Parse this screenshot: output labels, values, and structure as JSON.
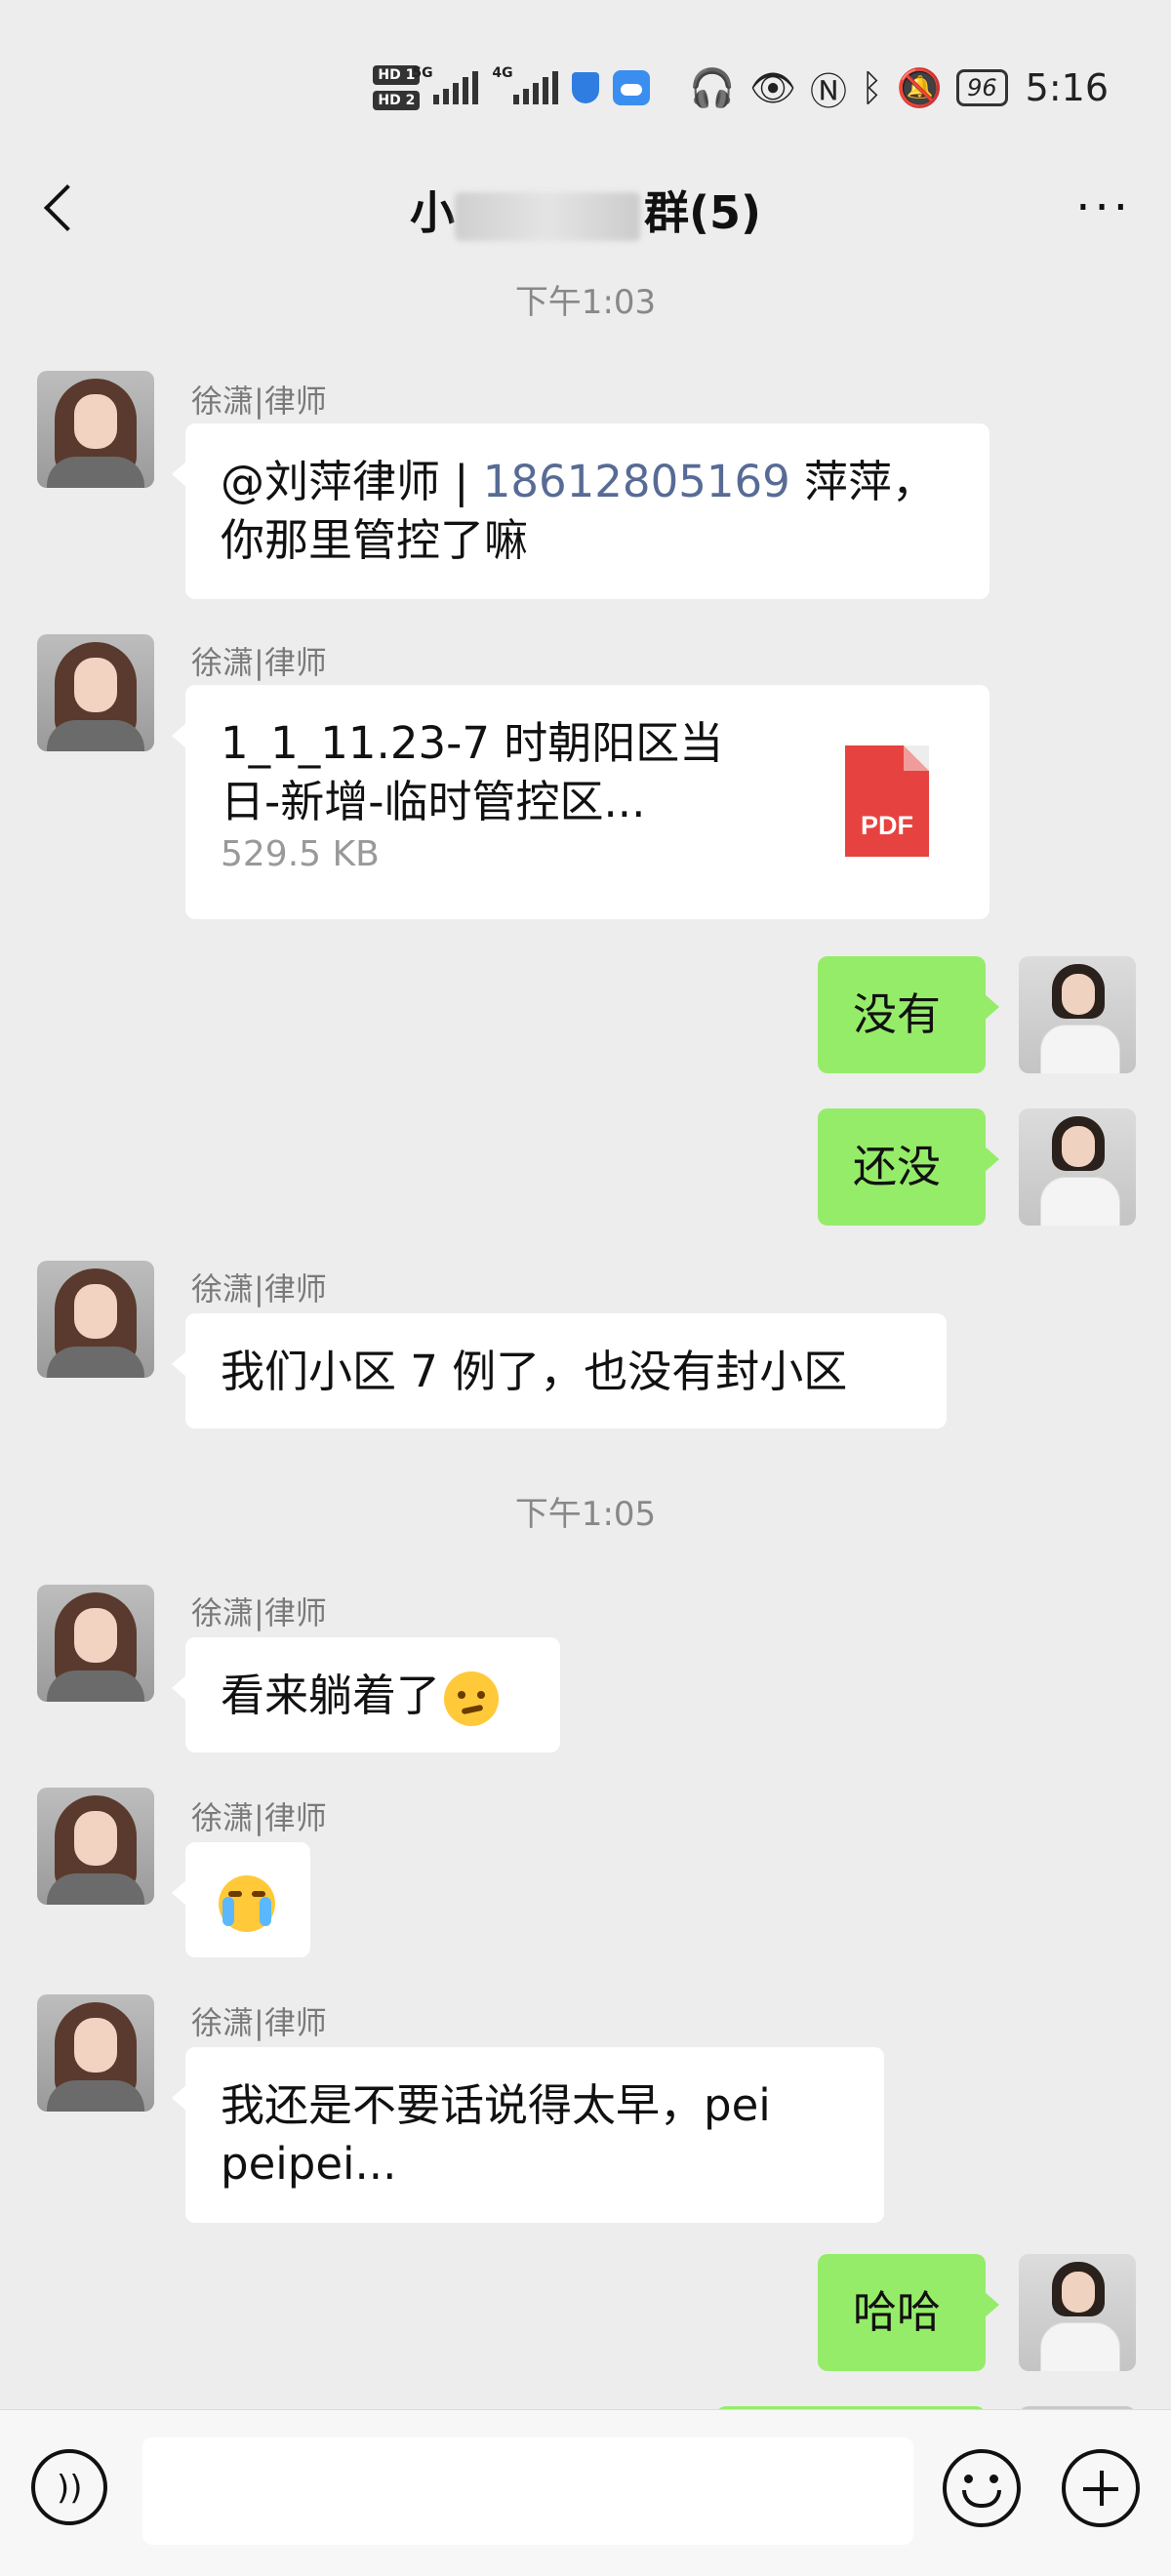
{
  "status_bar": {
    "hd1": "HD 1",
    "hd2": "HD 2",
    "net1": "5G",
    "net2": "4G",
    "battery": "96",
    "time": "5:16"
  },
  "header": {
    "title_visible": "群(5)",
    "title_prefix_visible": "小"
  },
  "messages": [
    {
      "type": "timestamp",
      "text": "下午1:03"
    },
    {
      "type": "incoming",
      "sender": "徐潇|律师",
      "mention": "@刘萍律师 | ",
      "mention_number": "18612805169",
      "text": " 萍萍，你那里管控了嘛"
    },
    {
      "type": "incoming_file",
      "sender": "徐潇|律师",
      "file_name": "1_1_11.23-7 时朝阳区当日-新增-临时管控区...",
      "file_size": "529.5 KB",
      "file_type": "PDF"
    },
    {
      "type": "outgoing",
      "text": "没有"
    },
    {
      "type": "outgoing",
      "text": "还没"
    },
    {
      "type": "incoming",
      "sender": "徐潇|律师",
      "text": "我们小区 7 例了，也没有封小区"
    },
    {
      "type": "timestamp",
      "text": "下午1:05"
    },
    {
      "type": "incoming",
      "sender": "徐潇|律师",
      "text": "看来躺着了",
      "emoji": "thinking-face"
    },
    {
      "type": "incoming_emoji",
      "sender": "徐潇|律师",
      "emoji": "crying-laughing-face"
    },
    {
      "type": "incoming",
      "sender": "徐潇|律师",
      "text": "我还是不要话说得太早，pei peipei..."
    },
    {
      "type": "outgoing",
      "text": "哈哈"
    }
  ],
  "input_bar": {
    "placeholder": ""
  },
  "icons": {
    "back": "chevron-left-icon",
    "more": "more-dots-icon",
    "voice": "voice-icon",
    "emoji": "smile-icon",
    "plus": "plus-icon"
  },
  "colors": {
    "background": "#ededed",
    "incoming_bubble": "#ffffff",
    "outgoing_bubble": "#95ec69",
    "link": "#576b95",
    "pdf": "#e64340"
  }
}
